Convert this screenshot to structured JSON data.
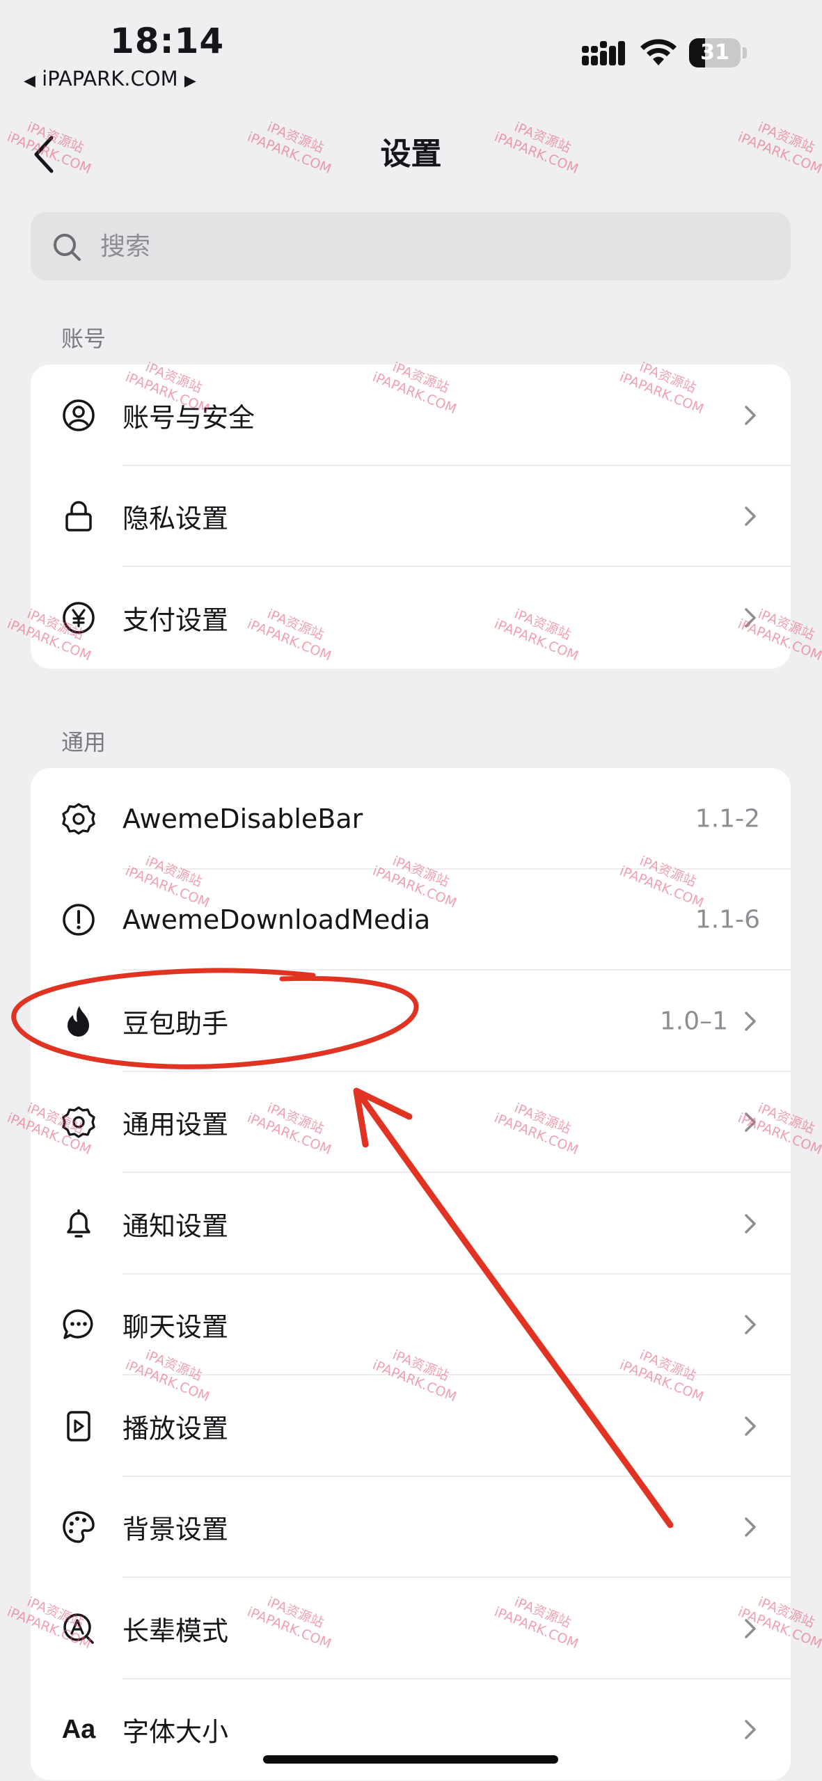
{
  "status_bar": {
    "time": "18:14",
    "carrier": "iPAPARK.COM",
    "carrier_left": "◀",
    "carrier_right": "▶",
    "battery": "31",
    "battery_level": 0.31
  },
  "nav": {
    "title": "设置"
  },
  "search": {
    "placeholder": "搜索"
  },
  "sections": [
    {
      "label": "账号",
      "items": [
        {
          "label": "账号与安全",
          "icon": "user-circle-icon"
        },
        {
          "label": "隐私设置",
          "icon": "lock-icon"
        },
        {
          "label": "支付设置",
          "icon": "yen-circle-icon"
        }
      ]
    },
    {
      "label": "通用",
      "items": [
        {
          "label": "AwemeDisableBar",
          "value": "1.1-2",
          "icon": "gear-icon"
        },
        {
          "label": "AwemeDownloadMedia",
          "value": "1.1-6",
          "icon": "alert-circle-icon"
        },
        {
          "label": "豆包助手",
          "value": "1.0–1",
          "icon": "flame-icon"
        },
        {
          "label": "通用设置",
          "icon": "gear-icon"
        },
        {
          "label": "通知设置",
          "icon": "bell-icon"
        },
        {
          "label": "聊天设置",
          "icon": "chat-bubble-icon"
        },
        {
          "label": "播放设置",
          "icon": "play-square-icon"
        },
        {
          "label": "背景设置",
          "icon": "palette-icon"
        },
        {
          "label": "长辈模式",
          "icon": "elder-mode-icon"
        },
        {
          "label": "字体大小",
          "icon": "font-size-icon",
          "icon_text": "Aa"
        }
      ]
    }
  ],
  "watermark": {
    "line1": "iPA资源站",
    "line2": "iPAPARK.COM"
  },
  "annotation": {
    "color": "#e03322"
  }
}
